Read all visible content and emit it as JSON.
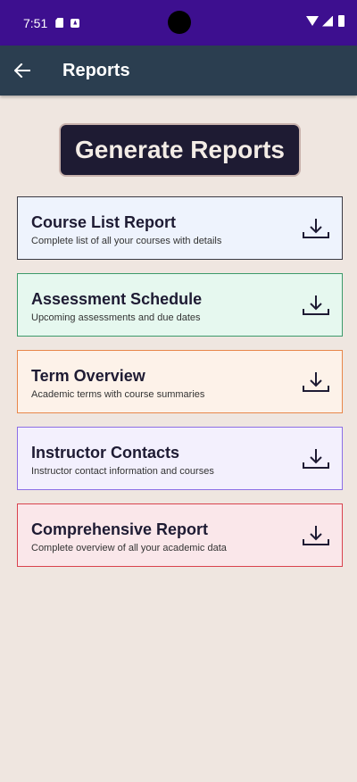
{
  "status_bar": {
    "time": "7:51"
  },
  "app_bar": {
    "back_icon": "arrow-left-icon",
    "title": "Reports"
  },
  "generate_button": {
    "label": "Generate Reports"
  },
  "reports": [
    {
      "title": "Course List Report",
      "description": "Complete list of all your courses with details",
      "bg": "#eef3fd",
      "border": "#3a3a44"
    },
    {
      "title": "Assessment Schedule",
      "description": "Upcoming assessments and due dates",
      "bg": "#e6f8ef",
      "border": "#3d9a6a"
    },
    {
      "title": "Term Overview",
      "description": "Academic terms with course summaries",
      "bg": "#fdf2e9",
      "border": "#e8874a"
    },
    {
      "title": "Instructor Contacts",
      "description": "Instructor contact information and courses",
      "bg": "#f3f0fd",
      "border": "#8c6ee6"
    },
    {
      "title": "Comprehensive Report",
      "description": "Complete overview of all your academic data",
      "bg": "#fae7ea",
      "border": "#d9434e"
    }
  ],
  "colors": {
    "status_bar": "#3d0f8f",
    "app_bar": "#2b3e50",
    "background": "#efe6e0",
    "generate_button": "#1e1b33"
  }
}
